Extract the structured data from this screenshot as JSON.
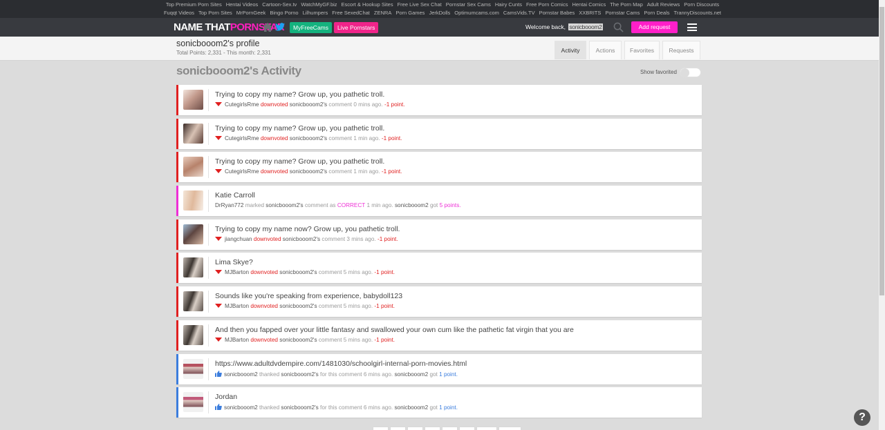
{
  "top_links": {
    "row1": [
      "Top Premium Porn Sites",
      "Hentai Videos",
      "Cartoon-Sex.tv",
      "WatchMyGF.biz",
      "Escort & Hookup Sites",
      "Free Live Sex Chat",
      "Pornstar Sex Cams",
      "Hairy Cunts",
      "Free Porn Comics",
      "Hentai Comics",
      "The Porn Map",
      "Adult Reviews",
      "Porn Discounts"
    ],
    "row2": [
      "Fuqqt Videos",
      "Top Porn Sites",
      "MrPornGeek",
      "Bingo Porno",
      "Lilhumpers",
      "Free SexedChat",
      "ZENRA",
      "Porn Games",
      "JerkDolls",
      "Optimumcams.com",
      "CamsVids.TV",
      "Pornstar Babes",
      "XXBRITS",
      "Pornstar Cams",
      "Porn Deals",
      "TrannyDiscounts.net"
    ]
  },
  "navbar": {
    "logo_white": "NAME THAT",
    "logo_pink": "PORNSTAR",
    "myfreecams_label": "MyFreeCams",
    "live_pornstars_label": "Live Pornstars",
    "welcome_text": "Welcome back,",
    "username": "sonicbooom2",
    "add_request_label": "Add request"
  },
  "profile": {
    "name": "sonicbooom2's profile",
    "points": "Total Points: 2,331 - This month: 2,331",
    "tabs": [
      "Activity",
      "Actions",
      "Favorites",
      "Requests"
    ]
  },
  "activity_title": "sonicbooom2's Activity",
  "show_favorited_label": "Show favorited",
  "feed": [
    {
      "type": "down",
      "title": "Trying to copy my name? Grow up, you pathetic troll.",
      "user": "CutegirlsRme",
      "action": "downvoted",
      "target": "sonicbooom2's",
      "mid": "comment 0 mins ago.",
      "points": "-1 point."
    },
    {
      "type": "down",
      "title": "Trying to copy my name? Grow up, you pathetic troll.",
      "user": "CutegirlsRme",
      "action": "downvoted",
      "target": "sonicbooom2's",
      "mid": "comment 1 min ago.",
      "points": "-1 point."
    },
    {
      "type": "down",
      "title": "Trying to copy my name? Grow up, you pathetic troll.",
      "user": "CutegirlsRme",
      "action": "downvoted",
      "target": "sonicbooom2's",
      "mid": "comment 1 min ago.",
      "points": "-1 point."
    },
    {
      "type": "correct",
      "title": "Katie Carroll",
      "user": "DrRyan772",
      "action": "marked",
      "target": "sonicbooom2's",
      "mid": "comment as",
      "status": "CORRECT",
      "time": "1 min ago.",
      "owner": "sonicbooom2",
      "got": "got",
      "points": "5 points."
    },
    {
      "type": "down",
      "title": "Trying to copy my name now? Grow up, you pathetic troll.",
      "user": "jiangchuan",
      "action": "downvoted",
      "target": "sonicbooom2's",
      "mid": "comment 3 mins ago.",
      "points": "-1 point."
    },
    {
      "type": "down",
      "title": "Lima Skye?",
      "user": "MJBarton",
      "action": "downvoted",
      "target": "sonicbooom2's",
      "mid": "comment 5 mins ago.",
      "points": "-1 point."
    },
    {
      "type": "down",
      "title": "Sounds like you're speaking from experience, babydoll123",
      "user": "MJBarton",
      "action": "downvoted",
      "target": "sonicbooom2's",
      "mid": "comment 5 mins ago.",
      "points": "-1 point."
    },
    {
      "type": "down",
      "title": "And then you fapped over your little fantasy and swallowed your own cum like the pathetic fat virgin that you are",
      "user": "MJBarton",
      "action": "downvoted",
      "target": "sonicbooom2's",
      "mid": "comment 5 mins ago.",
      "points": "-1 point."
    },
    {
      "type": "thank",
      "title": "https://www.adultdvdempire.com/1481030/schoolgirl-internal-porn-movies.html",
      "user": "sonicbooom2",
      "action": "thanked",
      "target": "sonicbooom2's",
      "mid": "for this comment 6 mins ago.",
      "owner": "sonicbooom2",
      "got": "got",
      "points": "1 point."
    },
    {
      "type": "thank",
      "title": "Jordan",
      "user": "sonicbooom2",
      "action": "thanked",
      "target": "sonicbooom2's",
      "mid": "for this comment 6 mins ago.",
      "owner": "sonicbooom2",
      "got": "got",
      "points": "1 point."
    }
  ],
  "help_label": "?",
  "colors": {
    "accent_pink": "#ff1fc9",
    "green": "#14b27e",
    "downvote_red": "#e02020",
    "correct_pink": "#ee2fd6",
    "thank_blue": "#3b7ddd"
  }
}
